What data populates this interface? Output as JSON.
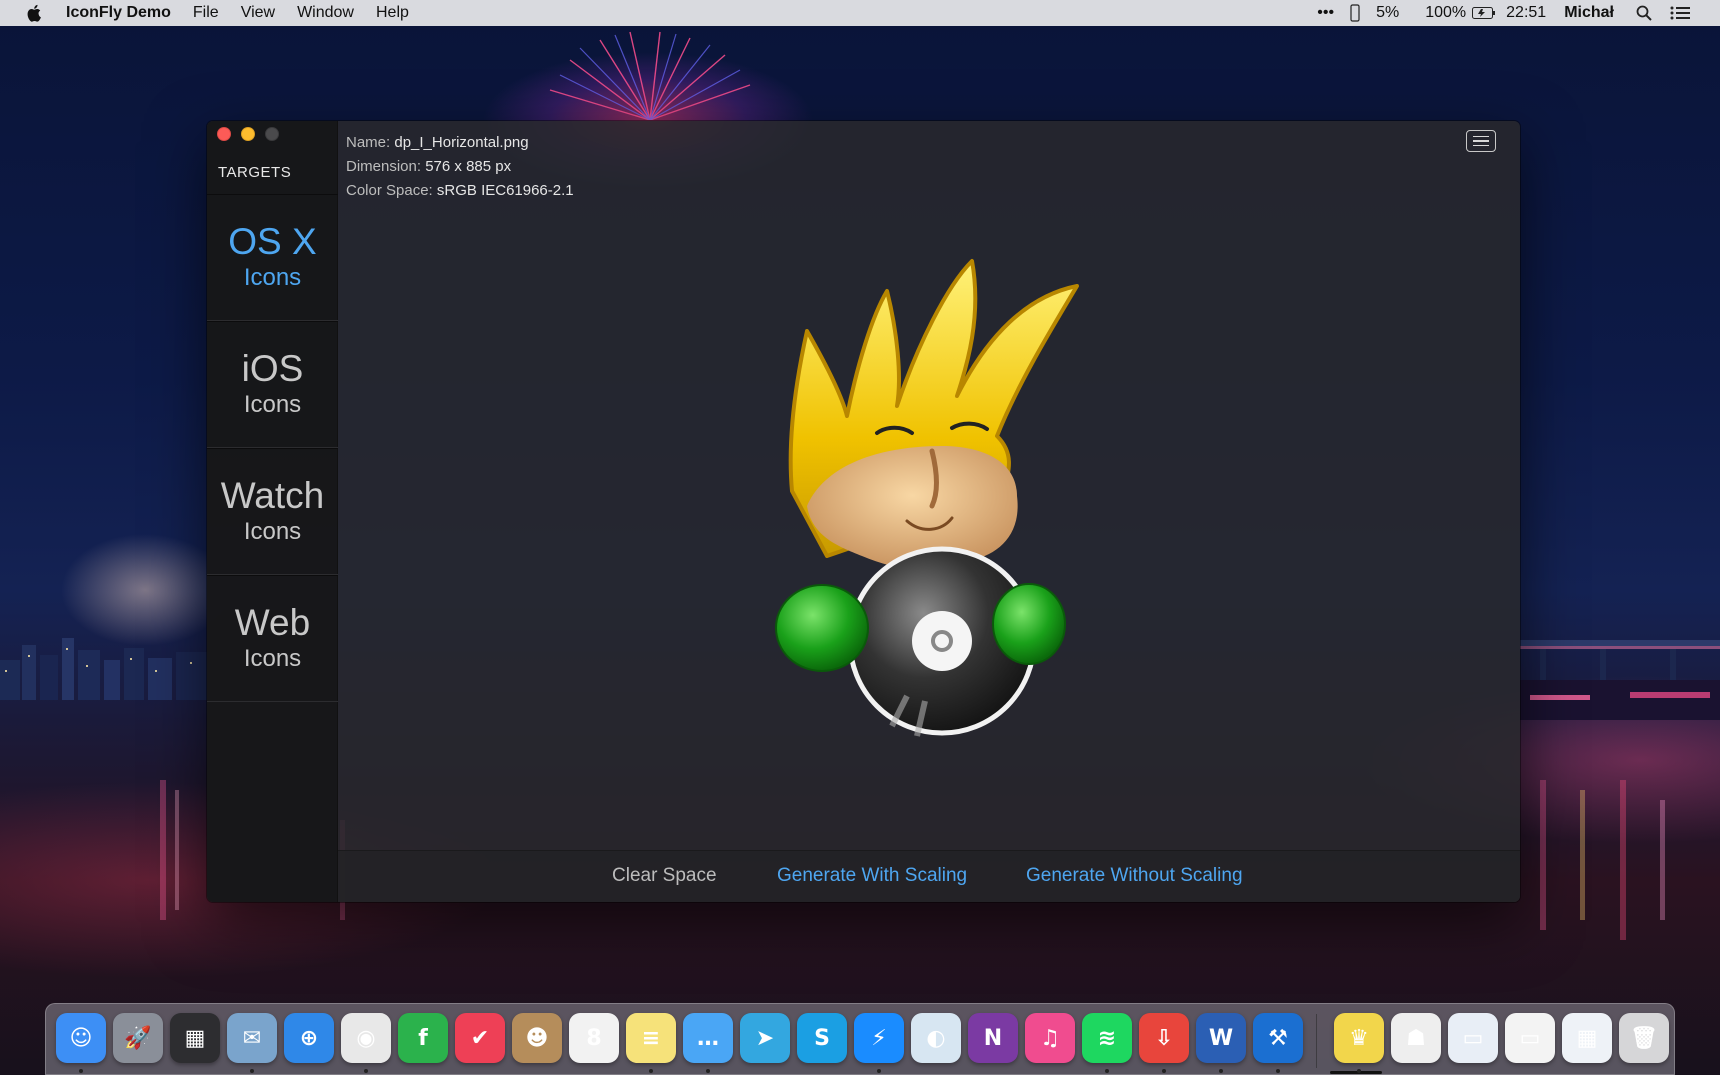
{
  "menubar": {
    "app_name": "IconFly Demo",
    "menus": [
      "File",
      "View",
      "Window",
      "Help"
    ],
    "status": {
      "overflow": "•••",
      "cpu": "5%",
      "battery": "100%",
      "time": "22:51",
      "user": "Michał"
    }
  },
  "window": {
    "sidebar": {
      "heading": "TARGETS",
      "targets": [
        {
          "main": "OS X",
          "sub": "Icons"
        },
        {
          "main": "iOS",
          "sub": "Icons"
        },
        {
          "main": "Watch",
          "sub": "Icons"
        },
        {
          "main": "Web",
          "sub": "Icons"
        }
      ],
      "active_index": 0
    },
    "info": {
      "name_key": "Name:",
      "name_value": "dp_I_Horizontal.png",
      "dimension_key": "Dimension:",
      "dimension_value": "576 x 885 px",
      "colorspace_key": "Color Space:",
      "colorspace_value": "sRGB IEC61966-2.1"
    },
    "footer": {
      "clear": "Clear Space",
      "with_scaling": "Generate With Scaling",
      "without_scaling": "Generate Without Scaling"
    }
  },
  "dock": {
    "apps": [
      {
        "name": "finder-icon",
        "glyph": "☺",
        "bg": "#3d8ff5",
        "running": true
      },
      {
        "name": "launchpad-icon",
        "glyph": "🚀",
        "bg": "#8a8f99",
        "running": false
      },
      {
        "name": "mission-control-icon",
        "glyph": "▦",
        "bg": "#2d2d30",
        "running": false
      },
      {
        "name": "preview-icon",
        "glyph": "✉",
        "bg": "#7aa4cc",
        "running": true
      },
      {
        "name": "safari-icon",
        "glyph": "⊕",
        "bg": "#2f88e8",
        "running": false
      },
      {
        "name": "chrome-icon",
        "glyph": "◉",
        "bg": "#e8e8e8",
        "running": true
      },
      {
        "name": "feedly-icon",
        "glyph": "f",
        "bg": "#2bb24c",
        "running": false
      },
      {
        "name": "pocket-icon",
        "glyph": "✔",
        "bg": "#ee4056",
        "running": false
      },
      {
        "name": "contacts-icon",
        "glyph": "☻",
        "bg": "#b58d5b",
        "running": false
      },
      {
        "name": "calendar-icon",
        "glyph": "8",
        "bg": "#f2f2f2",
        "running": false
      },
      {
        "name": "notes-icon",
        "glyph": "≡",
        "bg": "#f6e27a",
        "running": true
      },
      {
        "name": "messages-icon",
        "glyph": "…",
        "bg": "#4aa6f5",
        "running": true
      },
      {
        "name": "telegram-icon",
        "glyph": "➤",
        "bg": "#33a7e0",
        "running": false
      },
      {
        "name": "skype-icon",
        "glyph": "S",
        "bg": "#1b9fe3",
        "running": false
      },
      {
        "name": "messenger-icon",
        "glyph": "⚡",
        "bg": "#1a8cff",
        "running": true
      },
      {
        "name": "photo-icon",
        "glyph": "◐",
        "bg": "#d7e6f2",
        "running": false
      },
      {
        "name": "onenote-icon",
        "glyph": "N",
        "bg": "#7b3aa3",
        "running": false
      },
      {
        "name": "itunes-icon",
        "glyph": "♫",
        "bg": "#f04c8f",
        "running": false
      },
      {
        "name": "spotify-icon",
        "glyph": "≋",
        "bg": "#1ed760",
        "running": true
      },
      {
        "name": "transmit-icon",
        "glyph": "⇩",
        "bg": "#e8453c",
        "running": true
      },
      {
        "name": "word-icon",
        "glyph": "W",
        "bg": "#2b5fb4",
        "running": true
      },
      {
        "name": "xcode-icon",
        "glyph": "⚒",
        "bg": "#1b6fd1",
        "running": true
      }
    ],
    "stack": [
      {
        "name": "iconfly-icon",
        "glyph": "♛",
        "bg": "#f2d64b",
        "running": true
      },
      {
        "name": "people-icon",
        "glyph": "☗",
        "bg": "#eeeeee",
        "running": false
      },
      {
        "name": "window-thumb-1-icon",
        "glyph": "▭",
        "bg": "#e8eef6",
        "running": false
      },
      {
        "name": "window-thumb-2-icon",
        "glyph": "▭",
        "bg": "#f3f3f3",
        "running": false
      },
      {
        "name": "window-thumb-3-icon",
        "glyph": "▦",
        "bg": "#eef2f7",
        "running": false
      },
      {
        "name": "trash-icon",
        "glyph": "🗑",
        "bg": "#d6d6d8",
        "running": false
      }
    ]
  }
}
